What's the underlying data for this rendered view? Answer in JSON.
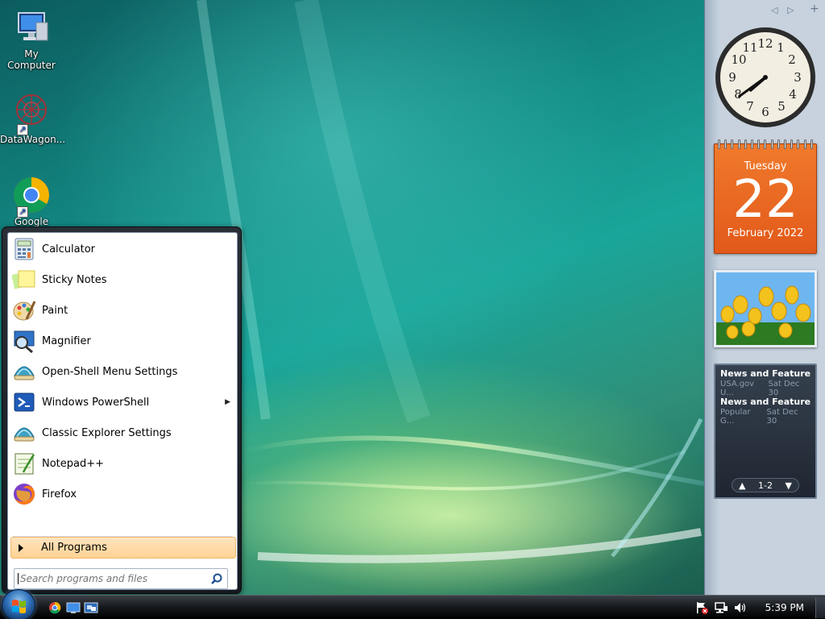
{
  "desktop": {
    "icons": [
      {
        "label": "My Computer"
      },
      {
        "label": "DataWagon..."
      },
      {
        "label": "Google"
      }
    ]
  },
  "sidebar": {
    "calendar": {
      "weekday": "Tuesday",
      "day": "22",
      "month_year": "February 2022"
    },
    "feeds": {
      "items": [
        {
          "title": "News and Features f...",
          "source": "USA.gov U...",
          "date": "Sat Dec 30"
        },
        {
          "title": "News and Features f...",
          "source": "Popular G...",
          "date": "Sat Dec 30"
        }
      ],
      "pager": "1-2"
    },
    "clock": {
      "hours": 7,
      "minutes": 39
    }
  },
  "start_menu": {
    "items": [
      {
        "label": "Calculator",
        "icon": "calculator-icon"
      },
      {
        "label": "Sticky Notes",
        "icon": "sticky-notes-icon"
      },
      {
        "label": "Paint",
        "icon": "paint-icon"
      },
      {
        "label": "Magnifier",
        "icon": "magnifier-icon"
      },
      {
        "label": "Open-Shell Menu Settings",
        "icon": "open-shell-icon"
      },
      {
        "label": "Windows PowerShell",
        "icon": "powershell-icon",
        "submenu": true
      },
      {
        "label": "Classic Explorer Settings",
        "icon": "classic-explorer-icon"
      },
      {
        "label": "Notepad++",
        "icon": "notepadpp-icon"
      },
      {
        "label": "Firefox",
        "icon": "firefox-icon"
      }
    ],
    "all_programs": "All Programs",
    "search_placeholder": "Search programs and files"
  },
  "taskbar": {
    "time": "5:39 PM"
  },
  "colors": {
    "calendar_accent": "#e8641f",
    "menu_highlight": "#ffd394",
    "taskbar": "#15181c"
  }
}
